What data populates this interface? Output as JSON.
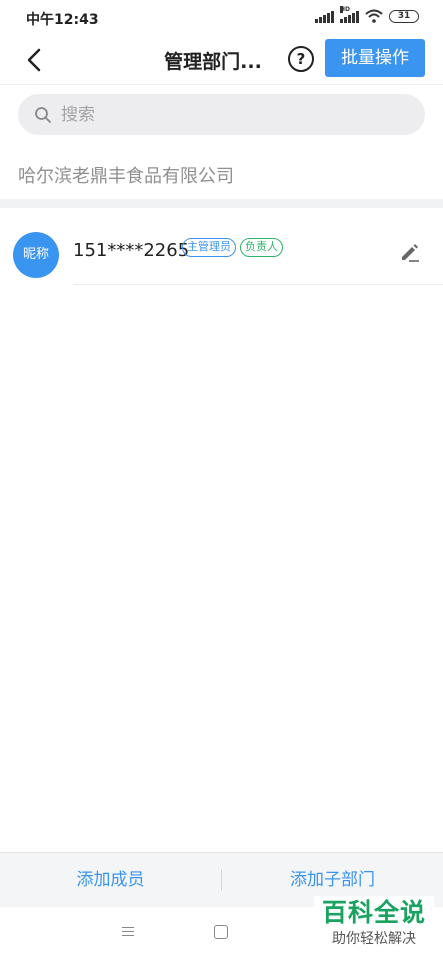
{
  "status_bar": {
    "time": "中午12:43",
    "battery": "31",
    "hd_label": "HD"
  },
  "header": {
    "title": "管理部门...",
    "help_label": "?",
    "batch_label": "批量操作"
  },
  "search": {
    "placeholder": "搜索"
  },
  "company_name": "哈尔滨老鼎丰食品有限公司",
  "members": [
    {
      "avatar_text": "昵称",
      "phone": "151****2265",
      "tags": [
        "主管理员",
        "负责人"
      ]
    }
  ],
  "bottom_bar": {
    "add_member": "添加成员",
    "add_subdepartment": "添加子部门"
  },
  "watermark": {
    "main": "百科全说",
    "sub": "助你轻松解决"
  },
  "colors": {
    "accent": "#3a95f0",
    "leader_tag": "#2fb36b",
    "watermark_green": "#1aa260"
  }
}
